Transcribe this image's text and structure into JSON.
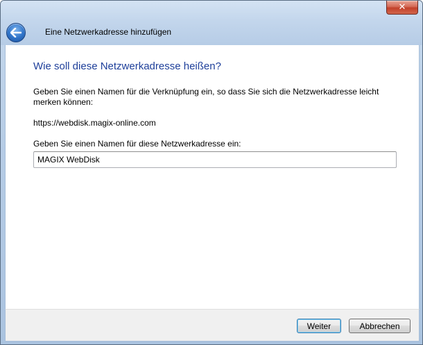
{
  "window": {
    "title": "Eine Netzwerkadresse hinzufügen",
    "close_label": "✕"
  },
  "content": {
    "heading": "Wie soll diese Netzwerkadresse heißen?",
    "description": "Geben Sie einen Namen für die Verknüpfung ein, so dass Sie sich die Netzwerkadresse leicht merken können:",
    "url": "https://webdisk.magix-online.com",
    "name_label": "Geben Sie einen Namen für diese Netzwerkadresse ein:",
    "name_value": "MAGIX WebDisk"
  },
  "buttons": {
    "next": "Weiter",
    "cancel": "Abbrechen"
  },
  "icons": {
    "back": "back-arrow-icon",
    "close": "close-icon"
  },
  "colors": {
    "heading": "#1e3f9a",
    "close_button": "#c2402a",
    "back_button": "#2f73c8"
  }
}
